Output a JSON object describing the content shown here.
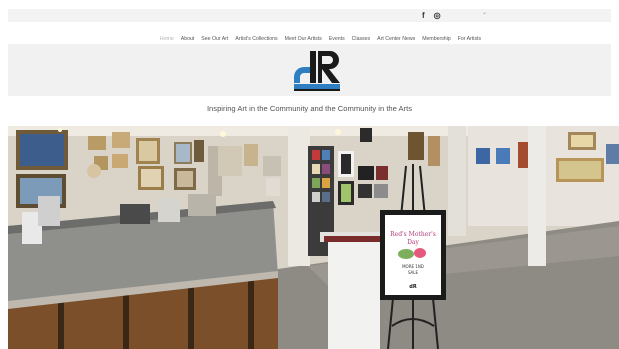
{
  "social": {
    "facebook_glyph": "f",
    "instagram_glyph": "◎",
    "extra_glyph": "⌄"
  },
  "nav": {
    "items": [
      {
        "label": "Home",
        "active": true
      },
      {
        "label": "About"
      },
      {
        "label": "See Our Art"
      },
      {
        "label": "Artist's Collections"
      },
      {
        "label": "Meet Our Artists"
      },
      {
        "label": "Events"
      },
      {
        "label": "Classes"
      },
      {
        "label": "Art Center News"
      },
      {
        "label": "Membership"
      },
      {
        "label": "For Artists"
      }
    ]
  },
  "logo": {
    "letters": "dR",
    "color_dark": "#1a1a1a",
    "color_accent": "#2f7ec1"
  },
  "tagline": "Inspiring Art in the Community and the Community in the Arts",
  "hero": {
    "easel_sign_line1": "Red's Mother's",
    "easel_sign_line2": "Day",
    "easel_sign_line3": "MORE 1ND",
    "easel_sign_line4": "SALE",
    "easel_sign_logo": "dR"
  }
}
